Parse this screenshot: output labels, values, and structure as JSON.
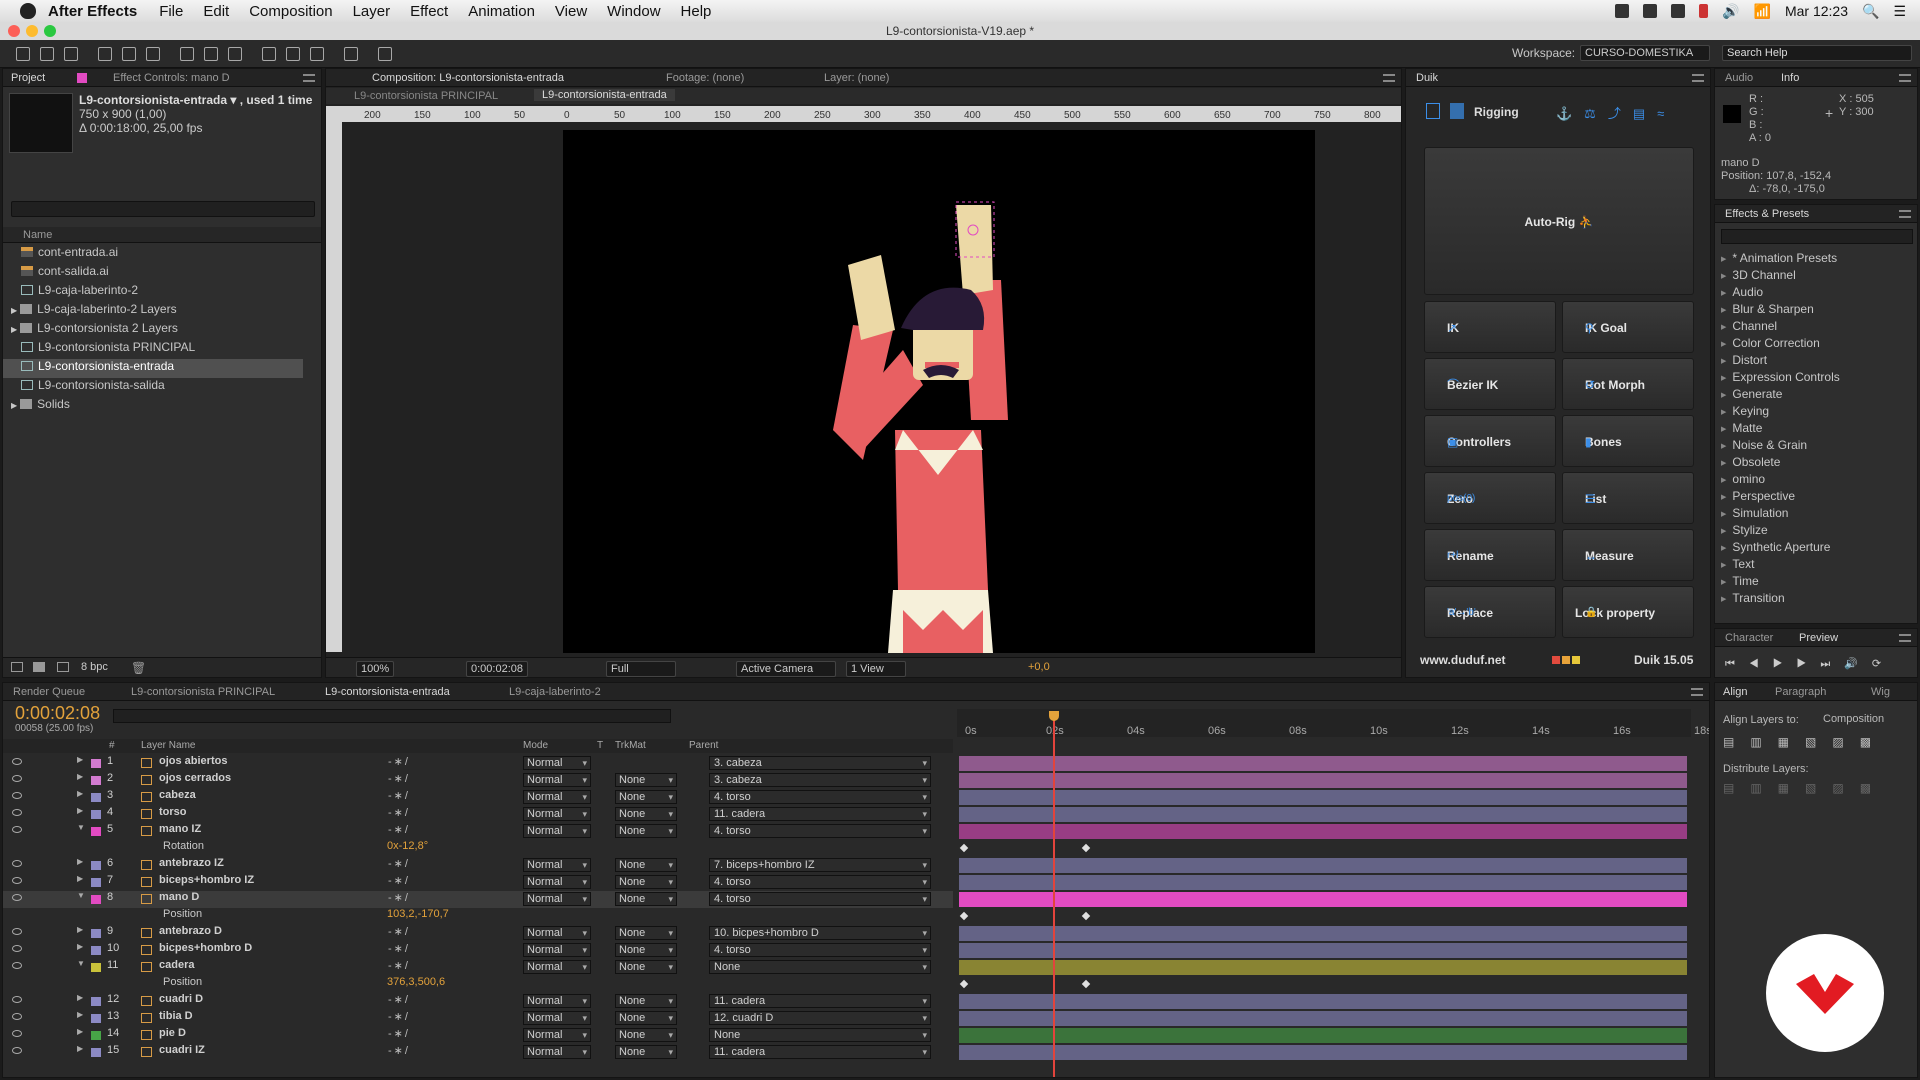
{
  "menubar": {
    "app": "After Effects",
    "items": [
      "File",
      "Edit",
      "Composition",
      "Layer",
      "Effect",
      "Animation",
      "View",
      "Window",
      "Help"
    ],
    "clock": "Mar 12:23"
  },
  "window": {
    "title": "L9-contorsionista-V19.aep *"
  },
  "toolbar": {
    "workspace_label": "Workspace:",
    "workspace_value": "CURSO-DOMESTIKA",
    "search_placeholder": "Search Help"
  },
  "project": {
    "tab_project": "Project",
    "tab_effect_controls": "Effect Controls: mano D",
    "item_name": "L9-contorsionista-entrada ▾ , used 1 time",
    "item_size": "750 x 900 (1,00)",
    "item_duration": "Δ 0:00:18:00, 25,00 fps",
    "col_name": "Name",
    "bpc": "8 bpc",
    "items": [
      "cont-entrada.ai",
      "cont-salida.ai",
      "L9-caja-laberinto-2",
      "L9-caja-laberinto-2 Layers",
      "L9-contorsionista 2 Layers",
      "L9-contorsionista PRINCIPAL",
      "L9-contorsionista-entrada",
      "L9-contorsionista-salida",
      "Solids"
    ]
  },
  "composition": {
    "tab": "Composition: L9-contorsionista-entrada",
    "footage": "Footage: (none)",
    "layer": "Layer: (none)",
    "crumb1": "L9-contorsionista PRINCIPAL",
    "crumb2": "L9-contorsionista-entrada",
    "ruler": [
      "200",
      "150",
      "100",
      "50",
      "0",
      "50",
      "100",
      "150",
      "200",
      "250",
      "300",
      "350",
      "400",
      "450",
      "500",
      "550",
      "600",
      "650",
      "700",
      "750",
      "800"
    ],
    "zoom": "100%",
    "time": "0:00:02:08",
    "resolution": "Full",
    "camera": "Active Camera",
    "views": "1 View",
    "exposure": "+0,0"
  },
  "duik": {
    "tab": "Duik",
    "rigging": "Rigging",
    "autorig": "Auto-Rig",
    "buttons": [
      {
        "label": "IK",
        "icon": "↗"
      },
      {
        "label": "IK Goal",
        "icon": "⚲"
      },
      {
        "label": "Bezier IK",
        "icon": "⌒"
      },
      {
        "label": "Rot Morph",
        "icon": "↺"
      },
      {
        "label": "Controllers",
        "icon": "▣"
      },
      {
        "label": "Bones",
        "icon": "▮"
      },
      {
        "label": "Zero",
        "icon": "pos(0)"
      },
      {
        "label": "List",
        "icon": "☰"
      },
      {
        "label": "Rename",
        "icon": "r+l"
      },
      {
        "label": "Measure",
        "icon": "↔"
      },
      {
        "label": "Replace",
        "icon": "'a'→'b'"
      },
      {
        "label": "Lock property",
        "icon": "🔒"
      }
    ],
    "url": "www.duduf.net",
    "version": "Duik 15.05"
  },
  "info": {
    "tab_audio": "Audio",
    "tab_info": "Info",
    "r": "R :",
    "g": "G :",
    "b": "B :",
    "a": "A : 0",
    "x": "X : 505",
    "y": "Y : 300",
    "layer": "mano D",
    "position": "Position: 107,8, -152,4",
    "delta": "Δ: -78,0, -175,0"
  },
  "effects": {
    "tab": "Effects & Presets",
    "items": [
      "* Animation Presets",
      "3D Channel",
      "Audio",
      "Blur & Sharpen",
      "Channel",
      "Color Correction",
      "Distort",
      "Expression Controls",
      "Generate",
      "Keying",
      "Matte",
      "Noise & Grain",
      "Obsolete",
      "omino",
      "Perspective",
      "Simulation",
      "Stylize",
      "Synthetic Aperture",
      "Text",
      "Time",
      "Transition"
    ]
  },
  "preview": {
    "tab_character": "Character",
    "tab_preview": "Preview"
  },
  "align": {
    "tab_align": "Align",
    "tab_paragraph": "Paragraph",
    "tab_wiggler": "Wig",
    "align_to_label": "Align Layers to:",
    "align_to_value": "Composition",
    "distribute": "Distribute Layers:"
  },
  "timeline": {
    "tab_render": "Render Queue",
    "tab1": "L9-contorsionista PRINCIPAL",
    "tab2": "L9-contorsionista-entrada",
    "tab3": "L9-caja-laberinto-2",
    "timecode": "0:00:02:08",
    "frames": "00058 (25.00 fps)",
    "col_num": "#",
    "col_layer": "Layer Name",
    "col_mode": "Mode",
    "col_t": "T",
    "col_trkmat": "TrkMat",
    "col_parent": "Parent",
    "ticks": [
      "0s",
      "02s",
      "04s",
      "06s",
      "08s",
      "10s",
      "12s",
      "14s",
      "16s",
      "18s"
    ],
    "layers": [
      {
        "n": "1",
        "name": "ojos abiertos",
        "mode": "Normal",
        "trk": "",
        "parent": "3. cabeza",
        "color": "#d37bd0"
      },
      {
        "n": "2",
        "name": "ojos cerrados",
        "mode": "Normal",
        "trk": "None",
        "parent": "3. cabeza",
        "color": "#d37bd0"
      },
      {
        "n": "3",
        "name": "cabeza",
        "mode": "Normal",
        "trk": "None",
        "parent": "4. torso",
        "color": "#8c8ac4"
      },
      {
        "n": "4",
        "name": "torso",
        "mode": "Normal",
        "trk": "None",
        "parent": "11. cadera",
        "color": "#8c8ac4"
      },
      {
        "n": "5",
        "name": "mano IZ",
        "mode": "Normal",
        "trk": "None",
        "parent": "4. torso",
        "color": "#e24bc2",
        "prop": "Rotation",
        "val": "0x-12,8°"
      },
      {
        "n": "6",
        "name": "antebrazo IZ",
        "mode": "Normal",
        "trk": "None",
        "parent": "7. biceps+hombro IZ",
        "color": "#8c8ac4"
      },
      {
        "n": "7",
        "name": "biceps+hombro IZ",
        "mode": "Normal",
        "trk": "None",
        "parent": "4. torso",
        "color": "#8c8ac4"
      },
      {
        "n": "8",
        "name": "mano D",
        "mode": "Normal",
        "trk": "None",
        "parent": "4. torso",
        "color": "#e24bc2",
        "prop": "Position",
        "val": "103,2,-170,7"
      },
      {
        "n": "9",
        "name": "antebrazo D",
        "mode": "Normal",
        "trk": "None",
        "parent": "10. bicpes+hombro D",
        "color": "#8c8ac4"
      },
      {
        "n": "10",
        "name": "bicpes+hombro D",
        "mode": "Normal",
        "trk": "None",
        "parent": "4. torso",
        "color": "#8c8ac4"
      },
      {
        "n": "11",
        "name": "cadera",
        "mode": "Normal",
        "trk": "None",
        "parent": "None",
        "color": "#c9c23a",
        "prop": "Position",
        "val": "376,3,500,6"
      },
      {
        "n": "12",
        "name": "cuadri D",
        "mode": "Normal",
        "trk": "None",
        "parent": "11. cadera",
        "color": "#8c8ac4"
      },
      {
        "n": "13",
        "name": "tibia D",
        "mode": "Normal",
        "trk": "None",
        "parent": "12. cuadri D",
        "color": "#8c8ac4"
      },
      {
        "n": "14",
        "name": "pie D",
        "mode": "Normal",
        "trk": "None",
        "parent": "None",
        "color": "#47a547"
      },
      {
        "n": "15",
        "name": "cuadri IZ",
        "mode": "Normal",
        "trk": "None",
        "parent": "11. cadera",
        "color": "#8c8ac4"
      }
    ]
  }
}
